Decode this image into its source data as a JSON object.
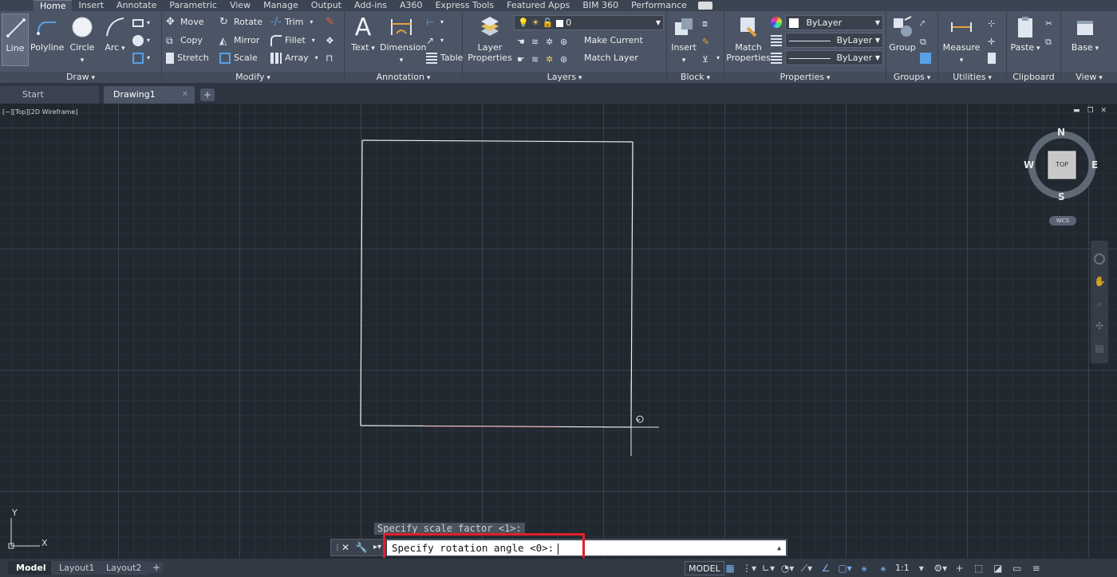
{
  "ribbon_tabs": [
    "Home",
    "Insert",
    "Annotate",
    "Parametric",
    "View",
    "Manage",
    "Output",
    "Add-ins",
    "A360",
    "Express Tools",
    "Featured Apps",
    "BIM 360",
    "Performance"
  ],
  "panels": {
    "draw": {
      "title": "Draw",
      "tools": [
        "Line",
        "Polyline",
        "Circle",
        "Arc"
      ]
    },
    "modify": {
      "title": "Modify",
      "tools": [
        "Move",
        "Rotate",
        "Trim",
        "Copy",
        "Mirror",
        "Fillet",
        "Stretch",
        "Scale",
        "Array"
      ]
    },
    "annotation": {
      "title": "Annotation",
      "tools": [
        "Text",
        "Dimension",
        "Table"
      ]
    },
    "layers": {
      "title": "Layers",
      "layer_properties": "Layer\nProperties",
      "layer_combo": "0",
      "make_current": "Make Current",
      "match_layer": "Match Layer"
    },
    "block": {
      "title": "Block",
      "insert": "Insert"
    },
    "properties": {
      "title": "Properties",
      "match_properties": "Match\nProperties",
      "color": "ByLayer",
      "linetype": "ByLayer",
      "lineweight": "ByLayer"
    },
    "groups": {
      "title": "Groups",
      "group": "Group"
    },
    "utilities": {
      "title": "Utilities",
      "measure": "Measure"
    },
    "clipboard": {
      "title": "Clipboard",
      "paste": "Paste"
    },
    "view": {
      "title": "View",
      "base": "Base"
    }
  },
  "file_tabs": [
    "Start",
    "Drawing1"
  ],
  "viewport": {
    "label": "[−][Top][2D Wireframe]",
    "compass": {
      "north": "N",
      "south": "S",
      "east": "E",
      "west": "W",
      "face": "TOP",
      "wcs": "WCS"
    },
    "ucs": {
      "x": "X",
      "y": "Y"
    }
  },
  "command": {
    "history": "Specify scale factor <1>:",
    "prompt": "Specify rotation angle <0>:"
  },
  "layout_tabs": [
    "Model",
    "Layout1",
    "Layout2"
  ],
  "status": {
    "model": "MODEL",
    "scale": "1:1"
  },
  "colors": {
    "ribbon": "#4b5566",
    "canvas": "#212830",
    "highlight": "#e0202a"
  }
}
